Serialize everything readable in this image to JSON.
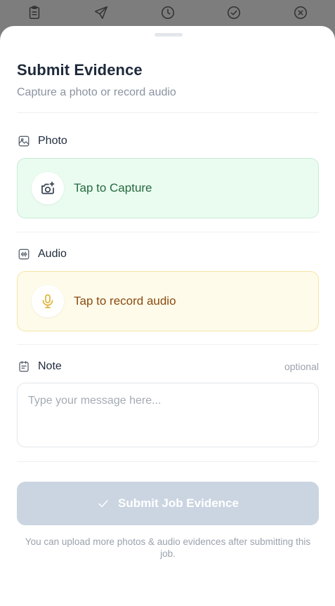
{
  "tabbar": {
    "icons": [
      "clipboard-icon",
      "send-icon",
      "history-icon",
      "check-circle-icon",
      "x-circle-icon"
    ]
  },
  "sheet": {
    "title": "Submit Evidence",
    "subtitle": "Capture a photo or record audio"
  },
  "photo": {
    "label": "Photo",
    "action_label": "Tap to Capture",
    "accent": "#eafbf0"
  },
  "audio": {
    "label": "Audio",
    "action_label": "Tap to record audio",
    "accent": "#fefbea"
  },
  "note": {
    "label": "Note",
    "optional": "optional",
    "placeholder": "Type your message here...",
    "value": ""
  },
  "submit": {
    "label": "Submit Job Evidence",
    "enabled": false,
    "color": "#cbd5e1"
  },
  "footnote": "You can upload more photos & audio evidences after submitting this job."
}
